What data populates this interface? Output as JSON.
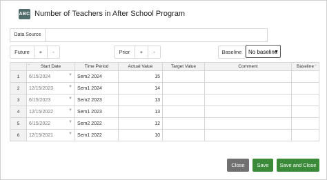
{
  "dialog": {
    "icon_text": "ABC",
    "title": "Number of Teachers in After School Program"
  },
  "data_source": {
    "label": "Data Source",
    "value": ""
  },
  "future": {
    "label": "Future",
    "plus": "+",
    "minus": "-"
  },
  "prior": {
    "label": "Prior",
    "plus": "+",
    "minus": "-"
  },
  "baseline": {
    "label": "Baseline",
    "selected": "No baseline"
  },
  "table": {
    "headers": [
      "",
      "Start Date",
      "Time Period",
      "Actual Value",
      "Target Value",
      "Comment",
      "Baseline"
    ],
    "rows": [
      {
        "num": "1",
        "start": "6/15/2024",
        "period": "Sem2 2024",
        "actual": "15",
        "target": "",
        "comment": "",
        "baseline": ""
      },
      {
        "num": "2",
        "start": "12/15/2023",
        "period": "Sem1 2024",
        "actual": "14",
        "target": "",
        "comment": "",
        "baseline": ""
      },
      {
        "num": "3",
        "start": "6/15/2023",
        "period": "Sem2 2023",
        "actual": "13",
        "target": "",
        "comment": "",
        "baseline": ""
      },
      {
        "num": "4",
        "start": "12/15/2022",
        "period": "Sem1 2023",
        "actual": "13",
        "target": "",
        "comment": "",
        "baseline": ""
      },
      {
        "num": "5",
        "start": "6/15/2022",
        "period": "Sem2 2022",
        "actual": "12",
        "target": "",
        "comment": "",
        "baseline": ""
      },
      {
        "num": "6",
        "start": "12/15/2021",
        "period": "Sem1 2022",
        "actual": "10",
        "target": "",
        "comment": "",
        "baseline": ""
      }
    ]
  },
  "buttons": {
    "close": "Close",
    "save": "Save",
    "save_close": "Save and Close"
  }
}
